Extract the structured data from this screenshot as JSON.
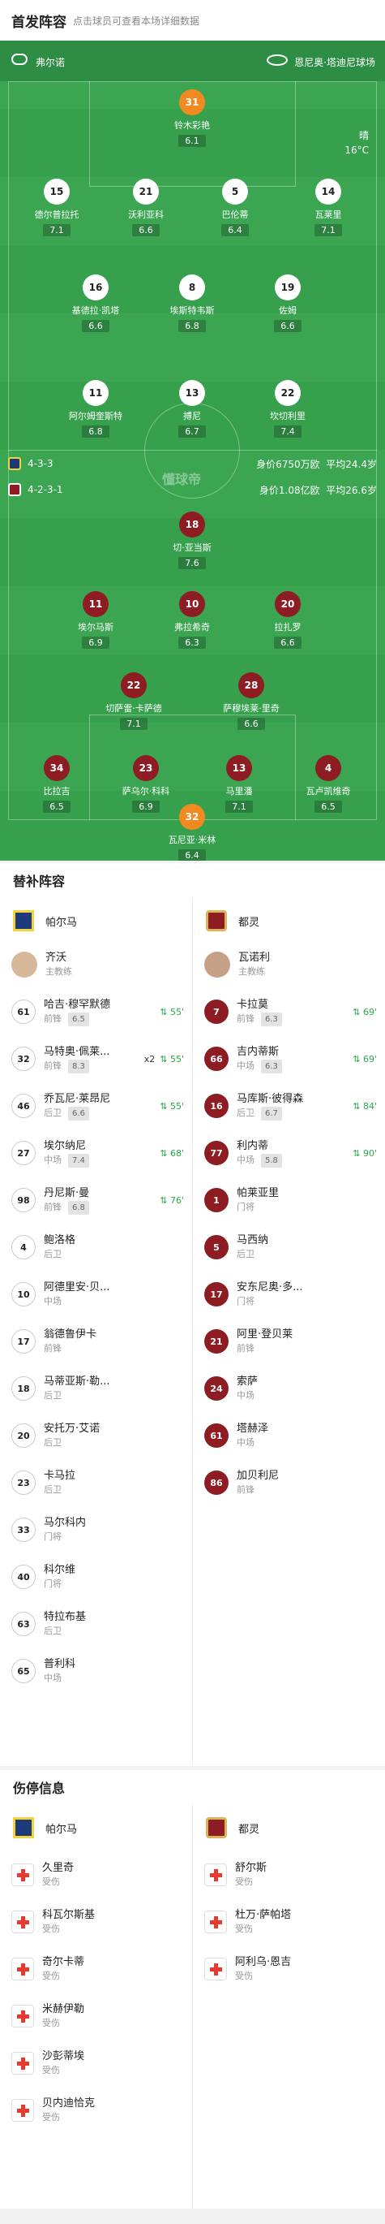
{
  "header": {
    "title": "首发阵容",
    "subtitle": "点击球员可查看本场详细数据"
  },
  "match": {
    "referee": "弗尔诺",
    "stadium": "恩尼奥·塔迪尼球场",
    "weather": "晴",
    "temp": "16°C"
  },
  "home": {
    "name": "帕尔马",
    "formation": "4-3-3",
    "value": "身价6750万欧",
    "age": "平均24.4岁",
    "coach": "齐沃",
    "coach_role": "主教练"
  },
  "away": {
    "name": "都灵",
    "formation": "4-2-3-1",
    "value": "身价1.08亿欧",
    "age": "平均26.6岁",
    "coach": "瓦诺利",
    "coach_role": "主教练"
  },
  "watermark": "懂球帝",
  "home_players": [
    {
      "num": "31",
      "name": "铃木彩艳",
      "rating": "6.1",
      "gk": true
    },
    {
      "num": "15",
      "name": "德尔普拉托",
      "rating": "7.1"
    },
    {
      "num": "21",
      "name": "沃利亚科",
      "rating": "6.6"
    },
    {
      "num": "5",
      "name": "巴伦蒂",
      "rating": "6.4",
      "sub": "55'"
    },
    {
      "num": "14",
      "name": "瓦莱里",
      "rating": "7.1"
    },
    {
      "num": "16",
      "name": "基德拉·凯塔",
      "rating": "6.6"
    },
    {
      "num": "8",
      "name": "埃斯特韦斯",
      "rating": "6.8",
      "sub": "55'"
    },
    {
      "num": "19",
      "name": "佐姆",
      "rating": "6.6",
      "sub": "68'"
    },
    {
      "num": "11",
      "name": "阿尔姆奎斯特",
      "rating": "6.8",
      "sub": "76'"
    },
    {
      "num": "13",
      "name": "搏尼",
      "rating": "6.7",
      "sub": "55'"
    },
    {
      "num": "22",
      "name": "坎切利里",
      "rating": "7.4"
    }
  ],
  "away_players": [
    {
      "num": "18",
      "name": "切·亚当斯",
      "rating": "7.6"
    },
    {
      "num": "11",
      "name": "埃尔马斯",
      "rating": "6.9",
      "sub": "69'"
    },
    {
      "num": "10",
      "name": "弗拉希奇",
      "rating": "6.3"
    },
    {
      "num": "20",
      "name": "拉扎罗",
      "rating": "6.6",
      "sub": "84'"
    },
    {
      "num": "22",
      "name": "切萨雷·卡萨德",
      "rating": "7.1",
      "sub": "69'"
    },
    {
      "num": "28",
      "name": "萨穆埃莱·里奇",
      "rating": "6.6",
      "sub": "90'"
    },
    {
      "num": "34",
      "name": "比拉吉",
      "rating": "6.5"
    },
    {
      "num": "23",
      "name": "萨乌尔·科科",
      "rating": "6.9"
    },
    {
      "num": "13",
      "name": "马里潘",
      "rating": "7.1"
    },
    {
      "num": "4",
      "name": "瓦卢凯维奇",
      "rating": "6.5"
    },
    {
      "num": "32",
      "name": "瓦尼亚·米林",
      "rating": "6.4",
      "gk": true
    }
  ],
  "subs_title": "替补阵容",
  "home_subs": [
    {
      "num": "61",
      "name": "哈吉·穆罕默德",
      "pos": "前锋",
      "rating": "6.5",
      "in": "55'"
    },
    {
      "num": "32",
      "name": "马特奥·佩莱...",
      "pos": "前锋",
      "rating": "8.3",
      "in": "55'",
      "extra": "x2"
    },
    {
      "num": "46",
      "name": "乔瓦尼·莱昂尼",
      "pos": "后卫",
      "rating": "6.6",
      "in": "55'"
    },
    {
      "num": "27",
      "name": "埃尔纳尼",
      "pos": "中场",
      "rating": "7.4",
      "in": "68'"
    },
    {
      "num": "98",
      "name": "丹尼斯·曼",
      "pos": "前锋",
      "rating": "6.8",
      "in": "76'"
    },
    {
      "num": "4",
      "name": "鲍洛格",
      "pos": "后卫"
    },
    {
      "num": "10",
      "name": "阿德里安·贝...",
      "pos": "中场"
    },
    {
      "num": "17",
      "name": "翁德鲁伊卡",
      "pos": "前锋"
    },
    {
      "num": "18",
      "name": "马蒂亚斯·勒...",
      "pos": "后卫"
    },
    {
      "num": "20",
      "name": "安托万·艾诺",
      "pos": "后卫"
    },
    {
      "num": "23",
      "name": "卡马拉",
      "pos": "后卫"
    },
    {
      "num": "33",
      "name": "马尔科内",
      "pos": "门将"
    },
    {
      "num": "40",
      "name": "科尔维",
      "pos": "门将"
    },
    {
      "num": "63",
      "name": "特拉布基",
      "pos": "后卫"
    },
    {
      "num": "65",
      "name": "普利科",
      "pos": "中场"
    }
  ],
  "away_subs": [
    {
      "num": "7",
      "name": "卡拉莫",
      "pos": "前锋",
      "rating": "6.3",
      "in": "69'"
    },
    {
      "num": "66",
      "name": "吉内蒂斯",
      "pos": "中场",
      "rating": "6.3",
      "in": "69'"
    },
    {
      "num": "16",
      "name": "马库斯·彼得森",
      "pos": "后卫",
      "rating": "6.7",
      "in": "84'"
    },
    {
      "num": "77",
      "name": "利内蒂",
      "pos": "中场",
      "rating": "5.8",
      "in": "90'"
    },
    {
      "num": "1",
      "name": "帕莱亚里",
      "pos": "门将"
    },
    {
      "num": "5",
      "name": "马西纳",
      "pos": "后卫"
    },
    {
      "num": "17",
      "name": "安东尼奥·多...",
      "pos": "门将"
    },
    {
      "num": "21",
      "name": "阿里·登贝莱",
      "pos": "前锋"
    },
    {
      "num": "24",
      "name": "索萨",
      "pos": "中场"
    },
    {
      "num": "61",
      "name": "塔赫泽",
      "pos": "中场"
    },
    {
      "num": "86",
      "name": "加贝利尼",
      "pos": "前锋"
    }
  ],
  "inj_title": "伤停信息",
  "home_inj": [
    {
      "name": "久里奇",
      "status": "受伤"
    },
    {
      "name": "科瓦尔斯基",
      "status": "受伤"
    },
    {
      "name": "奇尔卡蒂",
      "status": "受伤"
    },
    {
      "name": "米赫伊勒",
      "status": "受伤"
    },
    {
      "name": "沙彭蒂埃",
      "status": "受伤"
    },
    {
      "name": "贝内迪恰克",
      "status": "受伤"
    }
  ],
  "away_inj": [
    {
      "name": "舒尔斯",
      "status": "受伤"
    },
    {
      "name": "杜万·萨帕塔",
      "status": "受伤"
    },
    {
      "name": "阿利乌·恩吉",
      "status": "受伤"
    }
  ],
  "colors": {
    "pitch": "#3ba552",
    "home_shirt": "#ffffff",
    "away_shirt": "#8d1d22",
    "gk_shirt": "#f28a22",
    "positive": "#2aa84a"
  }
}
